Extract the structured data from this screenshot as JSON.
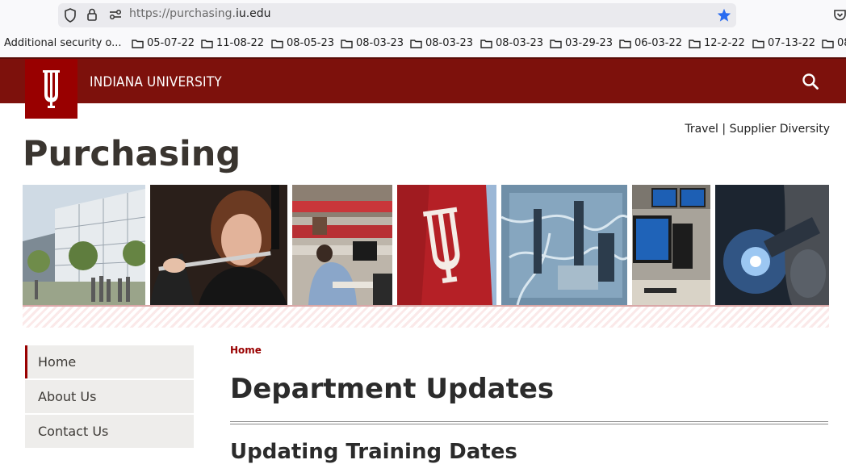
{
  "browser": {
    "url_prefix": "https://purchasing.",
    "url_domain": "iu.edu",
    "bookmarks": [
      "Additional security o...",
      "05-07-22",
      "11-08-22",
      "08-05-23",
      "08-03-23",
      "08-03-23",
      "08-03-23",
      "03-29-23",
      "06-03-22",
      "12-2-22",
      "07-13-22",
      "08"
    ]
  },
  "header": {
    "wordmark": "INDIANA UNIVERSITY",
    "search_icon": "search-icon",
    "brand_color": "#7d110c"
  },
  "top_links": {
    "travel": "Travel",
    "separator": "|",
    "supplier_diversity": "Supplier Diversity"
  },
  "site_title": "Purchasing",
  "nav": {
    "items": [
      "Home",
      "About Us",
      "Contact Us"
    ],
    "active": "Home"
  },
  "breadcrumb": "Home",
  "main": {
    "heading": "Department Updates",
    "next_heading": "Updating Training Dates"
  }
}
